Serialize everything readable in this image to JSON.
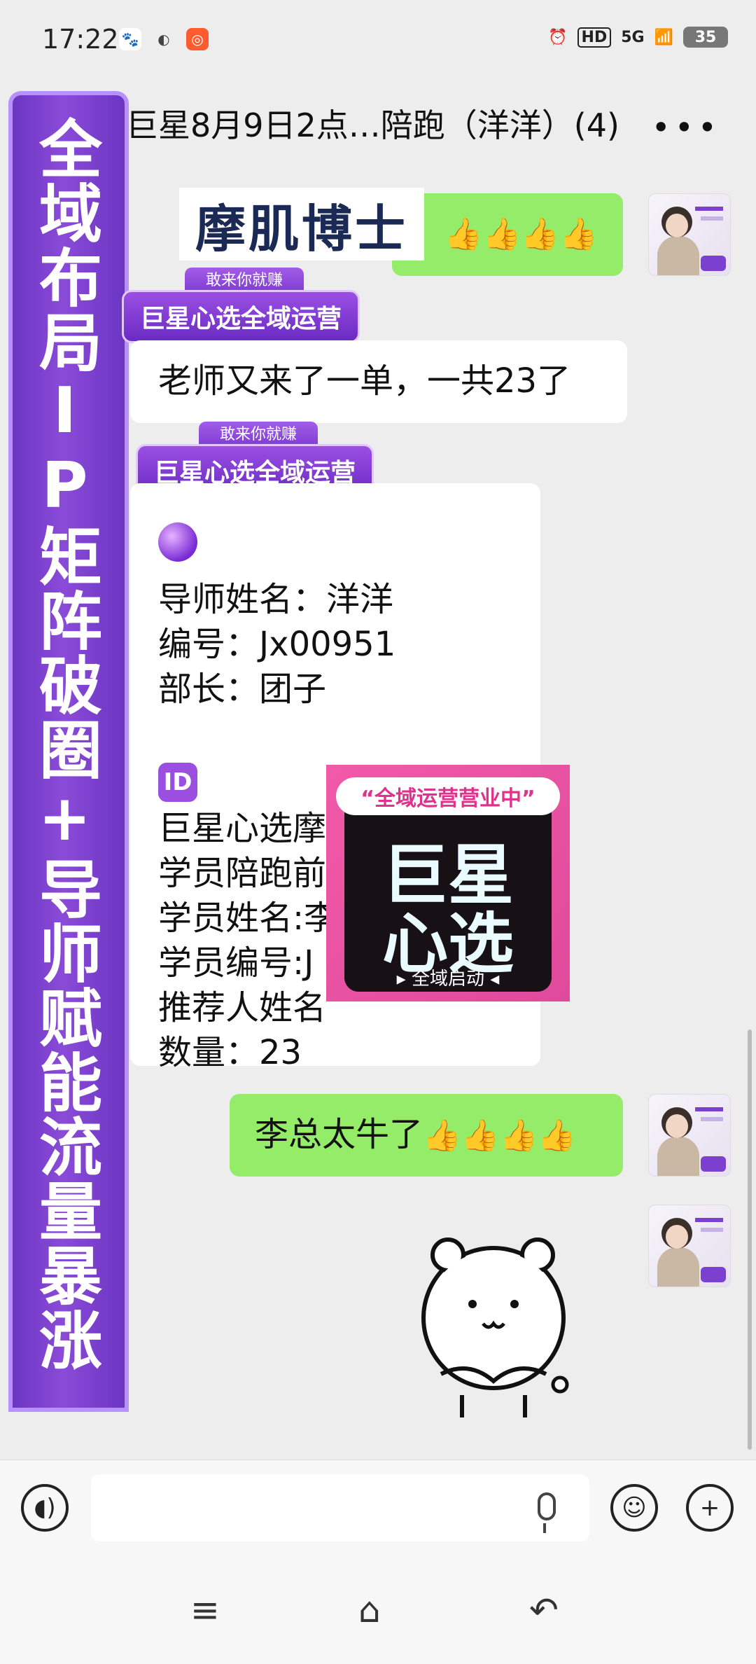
{
  "status_bar": {
    "time": "17:22",
    "network": "5G",
    "hd": "HD",
    "battery": "35"
  },
  "header": {
    "title": "巨星8月9日2点…陪跑（洋洋）(4)",
    "more": "•••"
  },
  "banner": {
    "text": "全域布局IP矩阵破圈+导师赋能流量暴涨"
  },
  "messages": {
    "logo_label": "摩肌博士",
    "thumbs": "👍👍👍👍",
    "badge_top": "敢来你就赚",
    "badge_main": "巨星心选全域运营",
    "msg2": "老师又来了一单，一共23了",
    "card": {
      "line1": "导师姓名：洋洋",
      "line2": "编号：Jx00951",
      "line3": "部长：团子",
      "id_icon": "ID",
      "line4": "巨星心选摩",
      "line5": "学员陪跑前",
      "line6": "学员姓名:李",
      "line7": "学员编号:J",
      "line8": "推荐人姓名",
      "line9": "数量：23"
    },
    "promo": {
      "banner": "“全域运营营业中”",
      "big1": "巨星",
      "big2": "心选",
      "sub": "▸ 全域启动 ◂"
    },
    "msg3_text": "李总太牛了",
    "msg3_thumbs": "👍👍👍👍"
  },
  "input_bar": {
    "voice_icon": "voice-icon",
    "emoji_icon": "emoji-icon",
    "plus_icon": "plus-icon"
  },
  "system_nav": {
    "menu": "≡",
    "home": "⌂",
    "back": "↶"
  }
}
